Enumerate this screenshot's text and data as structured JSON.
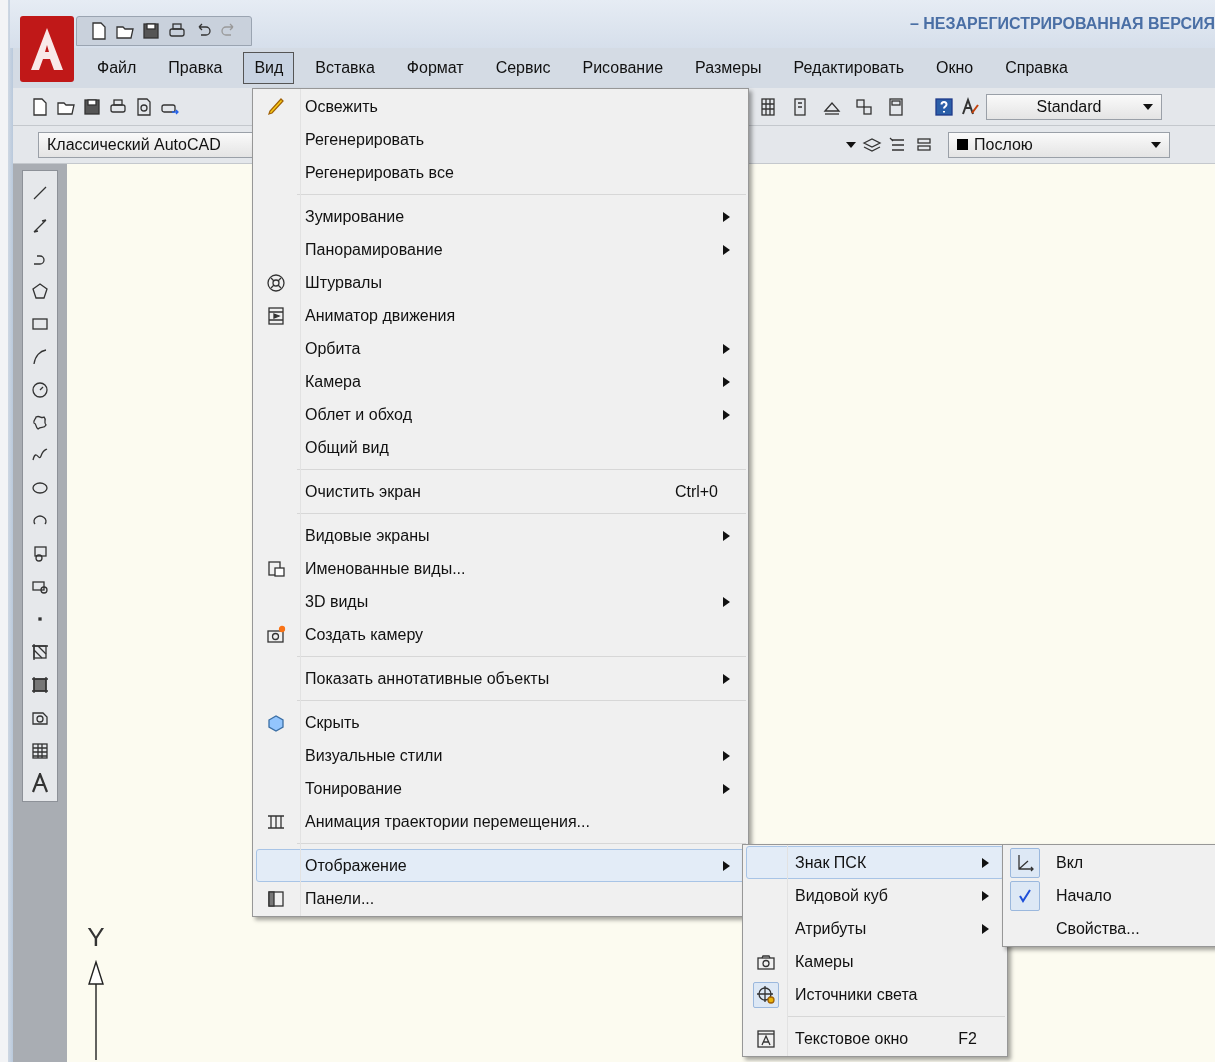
{
  "window": {
    "title": "– НЕЗАРЕГИСТРИРОВАННАЯ ВЕРСИЯ"
  },
  "menubar": [
    {
      "label": "Файл",
      "selected": false
    },
    {
      "label": "Правка",
      "selected": false
    },
    {
      "label": "Вид",
      "selected": true
    },
    {
      "label": "Вставка",
      "selected": false
    },
    {
      "label": "Формат",
      "selected": false
    },
    {
      "label": "Сервис",
      "selected": false
    },
    {
      "label": "Рисование",
      "selected": false
    },
    {
      "label": "Размеры",
      "selected": false
    },
    {
      "label": "Редактировать",
      "selected": false
    },
    {
      "label": "Окно",
      "selected": false
    },
    {
      "label": "Справка",
      "selected": false
    }
  ],
  "toolbar": {
    "text_style": "Standard",
    "workspace": "Классический AutoCAD",
    "color_control": "Послою"
  },
  "view_menu": [
    {
      "kind": "item",
      "label": "Освежить",
      "submenu": false,
      "selected": false
    },
    {
      "kind": "item",
      "label": "Регенерировать",
      "submenu": false,
      "selected": false
    },
    {
      "kind": "item",
      "label": "Регенерировать все",
      "submenu": false,
      "selected": false
    },
    {
      "kind": "separator"
    },
    {
      "kind": "item",
      "label": "Зумирование",
      "submenu": true,
      "selected": false
    },
    {
      "kind": "item",
      "label": "Панорамирование",
      "submenu": true,
      "selected": false
    },
    {
      "kind": "item",
      "label": "Штурвалы",
      "submenu": false,
      "selected": false
    },
    {
      "kind": "item",
      "label": "Аниматор движения",
      "submenu": false,
      "selected": false
    },
    {
      "kind": "item",
      "label": "Орбита",
      "submenu": true,
      "selected": false
    },
    {
      "kind": "item",
      "label": "Камера",
      "submenu": true,
      "selected": false
    },
    {
      "kind": "item",
      "label": "Облет и обход",
      "submenu": true,
      "selected": false
    },
    {
      "kind": "item",
      "label": "Общий вид",
      "submenu": false,
      "selected": false
    },
    {
      "kind": "separator"
    },
    {
      "kind": "item",
      "label": "Очистить экран",
      "shortcut": "Ctrl+0",
      "submenu": false,
      "selected": false
    },
    {
      "kind": "separator"
    },
    {
      "kind": "item",
      "label": "Видовые экраны",
      "submenu": true,
      "selected": false
    },
    {
      "kind": "item",
      "label": "Именованные виды...",
      "submenu": false,
      "selected": false
    },
    {
      "kind": "item",
      "label": "3D виды",
      "submenu": true,
      "selected": false
    },
    {
      "kind": "item",
      "label": "Создать камеру",
      "submenu": false,
      "selected": false
    },
    {
      "kind": "separator"
    },
    {
      "kind": "item",
      "label": "Показать аннотативные объекты",
      "submenu": true,
      "selected": false
    },
    {
      "kind": "separator"
    },
    {
      "kind": "item",
      "label": "Скрыть",
      "submenu": false,
      "selected": false
    },
    {
      "kind": "item",
      "label": "Визуальные стили",
      "submenu": true,
      "selected": false
    },
    {
      "kind": "item",
      "label": "Тонирование",
      "submenu": true,
      "selected": false
    },
    {
      "kind": "item",
      "label": "Анимация траектории перемещения...",
      "submenu": false,
      "selected": false
    },
    {
      "kind": "separator"
    },
    {
      "kind": "item",
      "label": "Отображение",
      "submenu": true,
      "selected": true
    },
    {
      "kind": "item",
      "label": "Панели...",
      "submenu": false,
      "selected": false
    }
  ],
  "display_menu": [
    {
      "kind": "item",
      "label": "Знак ПСК",
      "submenu": true,
      "selected": true
    },
    {
      "kind": "item",
      "label": "Видовой куб",
      "submenu": true,
      "selected": false
    },
    {
      "kind": "item",
      "label": "Атрибуты",
      "submenu": true,
      "selected": false
    },
    {
      "kind": "item",
      "label": "Камеры",
      "submenu": false,
      "selected": false,
      "checked": false
    },
    {
      "kind": "item",
      "label": "Источники света",
      "submenu": false,
      "selected": false,
      "checked": true
    },
    {
      "kind": "separator"
    },
    {
      "kind": "item",
      "label": "Текстовое окно",
      "shortcut": "F2",
      "submenu": false,
      "selected": false,
      "checked": false
    }
  ],
  "ucs_menu": [
    {
      "label": "Вкл",
      "checked": true
    },
    {
      "label": "Начало",
      "checked": true
    },
    {
      "label": "Свойства..."
    }
  ],
  "ucs_axis": {
    "label": "Y"
  }
}
